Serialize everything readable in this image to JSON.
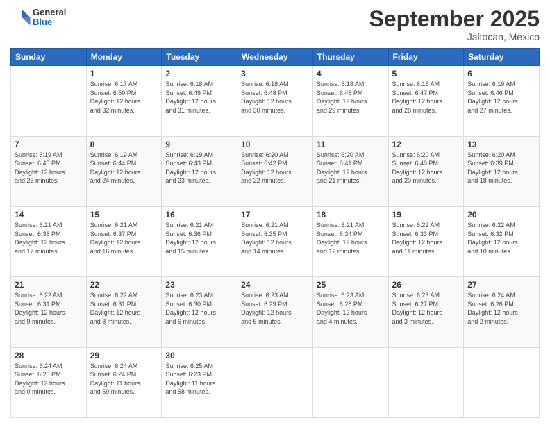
{
  "header": {
    "logo_general": "General",
    "logo_blue": "Blue",
    "month_title": "September 2025",
    "subtitle": "Jaltocan, Mexico"
  },
  "days_of_week": [
    "Sunday",
    "Monday",
    "Tuesday",
    "Wednesday",
    "Thursday",
    "Friday",
    "Saturday"
  ],
  "weeks": [
    [
      {
        "day": "",
        "info": ""
      },
      {
        "day": "1",
        "info": "Sunrise: 6:17 AM\nSunset: 6:50 PM\nDaylight: 12 hours\nand 32 minutes."
      },
      {
        "day": "2",
        "info": "Sunrise: 6:18 AM\nSunset: 6:49 PM\nDaylight: 12 hours\nand 31 minutes."
      },
      {
        "day": "3",
        "info": "Sunrise: 6:18 AM\nSunset: 6:48 PM\nDaylight: 12 hours\nand 30 minutes."
      },
      {
        "day": "4",
        "info": "Sunrise: 6:18 AM\nSunset: 6:48 PM\nDaylight: 12 hours\nand 29 minutes."
      },
      {
        "day": "5",
        "info": "Sunrise: 6:18 AM\nSunset: 6:47 PM\nDaylight: 12 hours\nand 28 minutes."
      },
      {
        "day": "6",
        "info": "Sunrise: 6:19 AM\nSunset: 6:46 PM\nDaylight: 12 hours\nand 27 minutes."
      }
    ],
    [
      {
        "day": "7",
        "info": "Sunrise: 6:19 AM\nSunset: 6:45 PM\nDaylight: 12 hours\nand 25 minutes."
      },
      {
        "day": "8",
        "info": "Sunrise: 6:19 AM\nSunset: 6:44 PM\nDaylight: 12 hours\nand 24 minutes."
      },
      {
        "day": "9",
        "info": "Sunrise: 6:19 AM\nSunset: 6:43 PM\nDaylight: 12 hours\nand 23 minutes."
      },
      {
        "day": "10",
        "info": "Sunrise: 6:20 AM\nSunset: 6:42 PM\nDaylight: 12 hours\nand 22 minutes."
      },
      {
        "day": "11",
        "info": "Sunrise: 6:20 AM\nSunset: 6:41 PM\nDaylight: 12 hours\nand 21 minutes."
      },
      {
        "day": "12",
        "info": "Sunrise: 6:20 AM\nSunset: 6:40 PM\nDaylight: 12 hours\nand 20 minutes."
      },
      {
        "day": "13",
        "info": "Sunrise: 6:20 AM\nSunset: 6:39 PM\nDaylight: 12 hours\nand 18 minutes."
      }
    ],
    [
      {
        "day": "14",
        "info": "Sunrise: 6:21 AM\nSunset: 6:38 PM\nDaylight: 12 hours\nand 17 minutes."
      },
      {
        "day": "15",
        "info": "Sunrise: 6:21 AM\nSunset: 6:37 PM\nDaylight: 12 hours\nand 16 minutes."
      },
      {
        "day": "16",
        "info": "Sunrise: 6:21 AM\nSunset: 6:36 PM\nDaylight: 12 hours\nand 15 minutes."
      },
      {
        "day": "17",
        "info": "Sunrise: 6:21 AM\nSunset: 6:35 PM\nDaylight: 12 hours\nand 14 minutes."
      },
      {
        "day": "18",
        "info": "Sunrise: 6:21 AM\nSunset: 6:34 PM\nDaylight: 12 hours\nand 12 minutes."
      },
      {
        "day": "19",
        "info": "Sunrise: 6:22 AM\nSunset: 6:33 PM\nDaylight: 12 hours\nand 11 minutes."
      },
      {
        "day": "20",
        "info": "Sunrise: 6:22 AM\nSunset: 6:32 PM\nDaylight: 12 hours\nand 10 minutes."
      }
    ],
    [
      {
        "day": "21",
        "info": "Sunrise: 6:22 AM\nSunset: 6:31 PM\nDaylight: 12 hours\nand 9 minutes."
      },
      {
        "day": "22",
        "info": "Sunrise: 6:22 AM\nSunset: 6:31 PM\nDaylight: 12 hours\nand 8 minutes."
      },
      {
        "day": "23",
        "info": "Sunrise: 6:23 AM\nSunset: 6:30 PM\nDaylight: 12 hours\nand 6 minutes."
      },
      {
        "day": "24",
        "info": "Sunrise: 6:23 AM\nSunset: 6:29 PM\nDaylight: 12 hours\nand 5 minutes."
      },
      {
        "day": "25",
        "info": "Sunrise: 6:23 AM\nSunset: 6:28 PM\nDaylight: 12 hours\nand 4 minutes."
      },
      {
        "day": "26",
        "info": "Sunrise: 6:23 AM\nSunset: 6:27 PM\nDaylight: 12 hours\nand 3 minutes."
      },
      {
        "day": "27",
        "info": "Sunrise: 6:24 AM\nSunset: 6:26 PM\nDaylight: 12 hours\nand 2 minutes."
      }
    ],
    [
      {
        "day": "28",
        "info": "Sunrise: 6:24 AM\nSunset: 6:25 PM\nDaylight: 12 hours\nand 0 minutes."
      },
      {
        "day": "29",
        "info": "Sunrise: 6:24 AM\nSunset: 6:24 PM\nDaylight: 11 hours\nand 59 minutes."
      },
      {
        "day": "30",
        "info": "Sunrise: 6:25 AM\nSunset: 6:23 PM\nDaylight: 11 hours\nand 58 minutes."
      },
      {
        "day": "",
        "info": ""
      },
      {
        "day": "",
        "info": ""
      },
      {
        "day": "",
        "info": ""
      },
      {
        "day": "",
        "info": ""
      }
    ]
  ]
}
